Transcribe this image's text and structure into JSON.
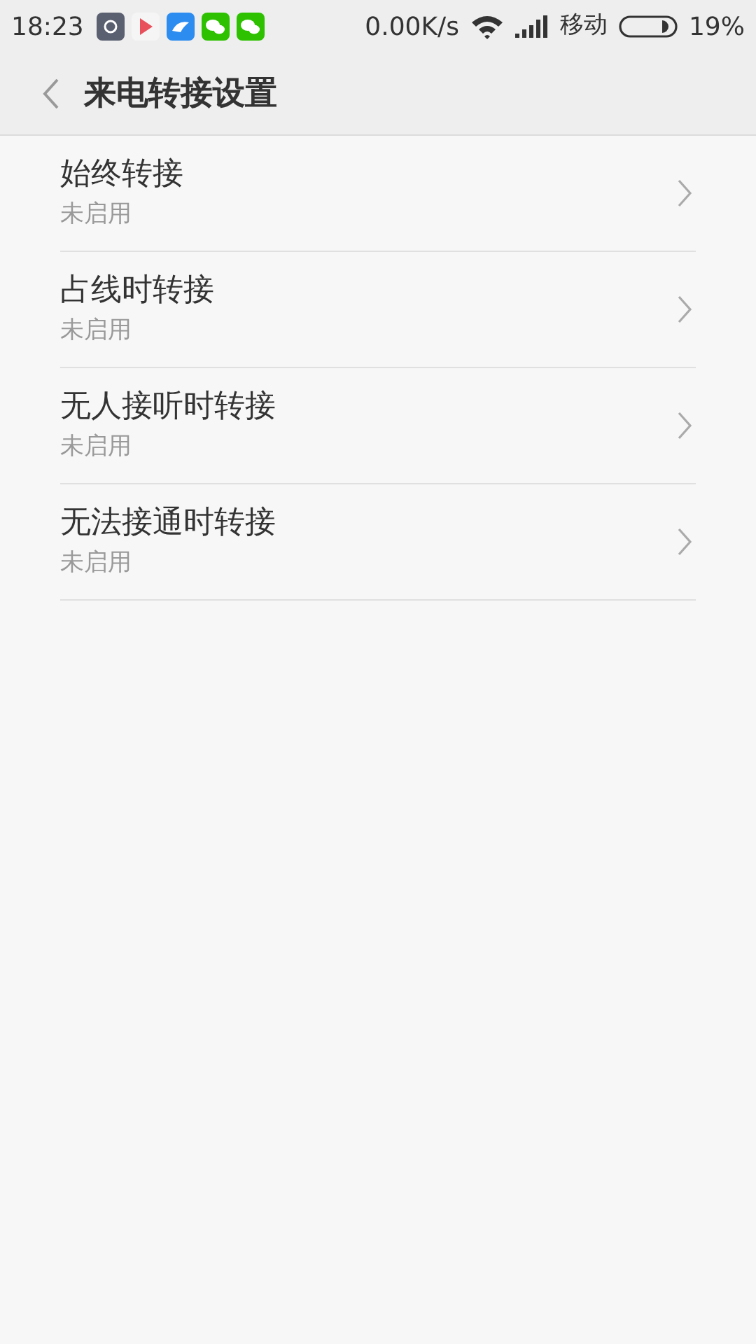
{
  "status_bar": {
    "time": "18:23",
    "speed": "0.00K/s",
    "carrier": "移动",
    "battery": "19%"
  },
  "header": {
    "title": "来电转接设置"
  },
  "items": [
    {
      "title": "始终转接",
      "status": "未启用"
    },
    {
      "title": "占线时转接",
      "status": "未启用"
    },
    {
      "title": "无人接听时转接",
      "status": "未启用"
    },
    {
      "title": "无法接通时转接",
      "status": "未启用"
    }
  ]
}
